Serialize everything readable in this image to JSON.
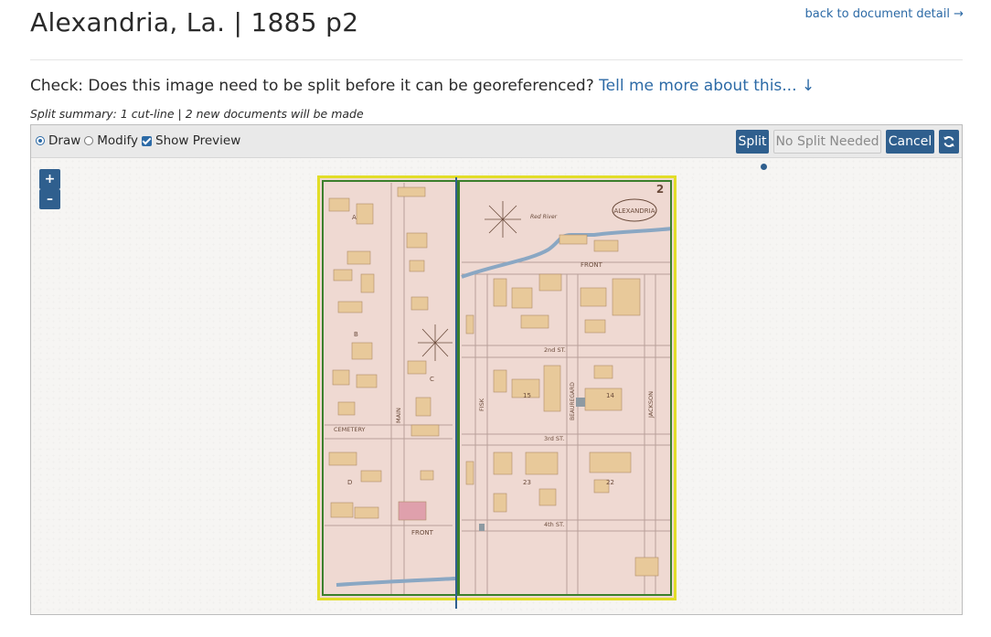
{
  "page": {
    "title": "Alexandria, La. | 1885 p2",
    "back_link": "back to document detail →"
  },
  "check": {
    "question": "Check: Does this image need to be split before it can be georeferenced?",
    "more_link": "Tell me more about this... ↓"
  },
  "summary": "Split summary: 1 cut-line | 2 new documents will be made",
  "toolbar": {
    "modes": [
      {
        "label": "Draw",
        "selected": true
      },
      {
        "label": "Modify",
        "selected": false
      }
    ],
    "preview": {
      "label": "Show Preview",
      "checked": true
    },
    "split_label": "Split",
    "no_split_label": "No Split Needed",
    "cancel_label": "Cancel",
    "refresh_icon": "refresh-icon"
  },
  "zoom": {
    "in_label": "+",
    "out_label": "–"
  },
  "map": {
    "sheet_number": "2",
    "cartouche": "ALEXANDRIA",
    "labels": {
      "front_top": "FRONT",
      "st_2nd": "2nd  ST.",
      "st_3rd": "3rd  ST.",
      "st_4th": "4th  ST.",
      "main": "MAIN",
      "fisk": "FISK",
      "beauregard": "BEAUREGARD",
      "jackson": "JACKSON",
      "cemetery": "CEMETERY",
      "front_bottom": "FRONT",
      "block_a": "A",
      "block_b": "B",
      "block_c": "C",
      "block_d": "D",
      "block_15": "15",
      "block_14": "14",
      "block_23": "23",
      "block_22": "22",
      "river": "Red  River"
    }
  },
  "colors": {
    "accent": "#2f5f8e",
    "link": "#2c6aa6",
    "map_border": "#e2dd27",
    "split_outline": "#3b7f2c",
    "map_paper": "#efd9d2",
    "river": "#8aa7c3",
    "building": "#e8c99a"
  }
}
